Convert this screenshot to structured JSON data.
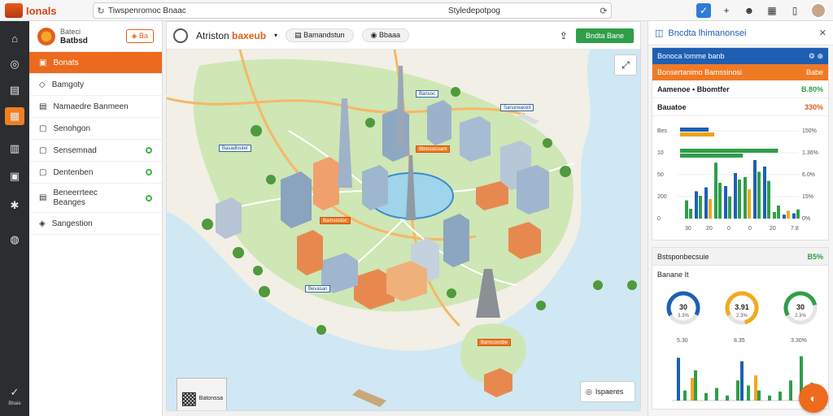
{
  "app": {
    "brand": "Ionals",
    "url_text": "Tiwspenromoc Bnaac",
    "url_center": "Styledepotpog"
  },
  "rail": {
    "items": [
      {
        "icon": "home-icon",
        "glyph": "⌂"
      },
      {
        "icon": "compass-icon",
        "glyph": "◎"
      },
      {
        "icon": "layers-icon",
        "glyph": "▤"
      },
      {
        "icon": "map-icon",
        "glyph": "▦"
      },
      {
        "icon": "calendar-icon",
        "glyph": "▥"
      },
      {
        "icon": "layout-icon",
        "glyph": "▣"
      },
      {
        "icon": "settings-icon",
        "glyph": "✱"
      },
      {
        "icon": "globe-icon",
        "glyph": "◍"
      },
      {
        "icon": "check-icon",
        "glyph": "✓"
      }
    ],
    "bottom_label": "Bbaie"
  },
  "sidebar": {
    "title_small": "Bateci",
    "title": "Batbsd",
    "badge": "Ba",
    "items": [
      {
        "label": "Bonats",
        "active": true,
        "dot": false
      },
      {
        "label": "Bamgoty",
        "active": false,
        "dot": false
      },
      {
        "label": "Namaedre Banmeen",
        "active": false,
        "dot": false
      },
      {
        "label": "Senohgon",
        "active": false,
        "dot": false
      },
      {
        "label": "Sensemnad",
        "active": false,
        "dot": true
      },
      {
        "label": "Dentenben",
        "active": false,
        "dot": true
      },
      {
        "label": "Beneerrteec",
        "label2": "Beanges",
        "active": false,
        "dot": true
      },
      {
        "label": "Sangestion",
        "active": false,
        "dot": false
      }
    ]
  },
  "map": {
    "title_prefix": "Atriston",
    "title_highlight": "baxeub",
    "pill1": "Bamandstun",
    "pill2": "Bbaaa",
    "action_button": "Bndta Bane",
    "search_label": "Ispaeres",
    "qr_label": "Batonssa",
    "labels": [
      {
        "text": "Bansoc",
        "style": "blue"
      },
      {
        "text": "Sanuneaceit",
        "style": "blue"
      },
      {
        "text": "Basadloutet",
        "style": "blue"
      },
      {
        "text": "Bbmssicoam",
        "style": "orange"
      },
      {
        "text": "Bamsestoc",
        "style": "orange"
      },
      {
        "text": "Bevasan",
        "style": "blue"
      },
      {
        "text": "Banscoosbe",
        "style": "orange"
      }
    ]
  },
  "rpanel": {
    "title": "Bncdta lhimanonsei",
    "rows": [
      {
        "label": "Bonoca lomme banb",
        "value": "",
        "style": "blue"
      },
      {
        "label": "Bonsertanimo Bamssinosi",
        "value": "Babe",
        "style": "orange"
      },
      {
        "label": "Aamenoe • Bbomtfer",
        "value": "B.80%",
        "style": "white"
      },
      {
        "label": "Bauatoe",
        "value": "330%",
        "style": "white"
      }
    ],
    "chart1": {
      "left_ticks": [
        "Bes",
        "10",
        "50",
        "200",
        "0"
      ],
      "right_ticks": [
        "150%",
        "1.36%",
        "6.0%",
        "15%",
        "0%"
      ],
      "x_ticks": [
        "30",
        "20",
        "0",
        "0",
        "20",
        "7.8"
      ]
    },
    "section2": {
      "head": "Bstsponbecsuie",
      "head_value": "B5%",
      "sub": "Banane It",
      "gauges": [
        {
          "value": "30",
          "sub": "3.3%",
          "color": "#1e5fb3",
          "frac": 0.66
        },
        {
          "value": "3.91",
          "sub": "2.3%",
          "color": "#f2a91e",
          "frac": 0.8
        },
        {
          "value": "30",
          "sub": "2.3%",
          "color": "#2f9e4a",
          "frac": 0.55
        }
      ],
      "tick_labels": [
        "5.30",
        "8.35",
        "3.30%"
      ]
    }
  },
  "chart_data": {
    "type": "bar",
    "series": [
      {
        "values": [
          28,
          42,
          48,
          86,
          50,
          70,
          64,
          90,
          80,
          10,
          6,
          8
        ]
      },
      {
        "values": [
          15,
          35,
          30,
          55,
          34,
          60,
          45,
          72,
          58,
          20,
          12,
          14
        ]
      }
    ],
    "hbars": [
      {
        "value": 0.25,
        "color": "#1e5fb3"
      },
      {
        "value": 0.3,
        "color": "#f0a11c"
      },
      {
        "value": 0.86,
        "color": "#2f9e4a"
      },
      {
        "value": 0.55,
        "color": "#2f9e4a"
      }
    ],
    "bottom_series": [
      {
        "color": "#1e5fb3",
        "values": [
          85,
          0,
          0,
          0,
          0,
          0,
          78,
          0,
          0,
          0,
          0,
          0,
          0
        ]
      },
      {
        "color": "#f2a91e",
        "values": [
          0,
          45,
          0,
          0,
          0,
          0,
          0,
          50,
          0,
          0,
          0,
          0,
          0
        ]
      },
      {
        "color": "#2f9e4a",
        "values": [
          20,
          60,
          15,
          25,
          10,
          40,
          30,
          20,
          10,
          18,
          40,
          88,
          35
        ]
      }
    ]
  }
}
